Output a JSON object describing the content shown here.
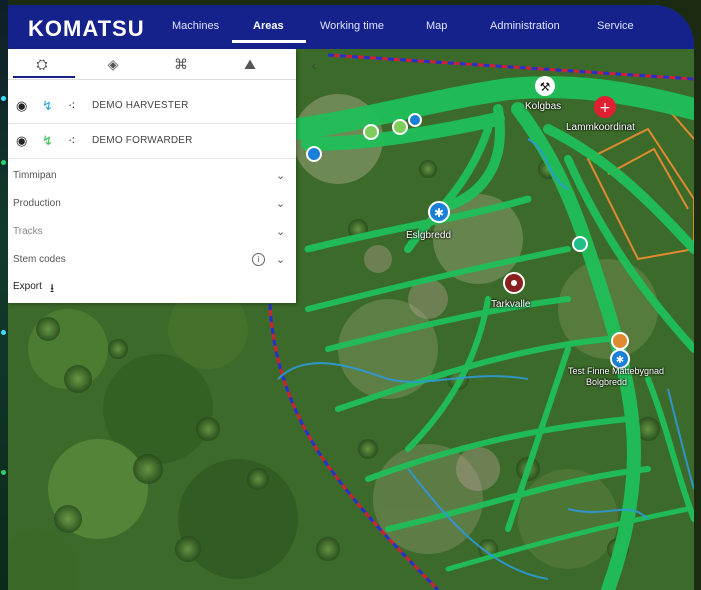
{
  "brand": {
    "logo": "KOMATSU"
  },
  "nav": {
    "items": [
      {
        "label": "Machines"
      },
      {
        "label": "Areas"
      },
      {
        "label": "Working time"
      },
      {
        "label": "Map"
      },
      {
        "label": "Administration"
      },
      {
        "label": "Service"
      }
    ],
    "active": "Areas"
  },
  "panel": {
    "tabs": [
      {
        "icon": "machine-icon"
      },
      {
        "icon": "layers-icon"
      },
      {
        "icon": "network-icon"
      },
      {
        "icon": "terrain-icon"
      }
    ],
    "collapse_icon": "chevron-left-icon",
    "machines": [
      {
        "name": "DEMO HARVESTER"
      },
      {
        "name": "DEMO FORWARDER"
      }
    ],
    "sections": [
      {
        "label": "Timmipan"
      },
      {
        "label": "Production"
      },
      {
        "label": "Tracks"
      },
      {
        "label": "Stem codes"
      }
    ],
    "export_label": "Export"
  },
  "map": {
    "labels": [
      {
        "text": "Kolgbas"
      },
      {
        "text": "Lammkoordinat"
      },
      {
        "text": "Eslgbredd"
      },
      {
        "text": "Tarkvalle"
      },
      {
        "text": "Test Finne Mattebygnad"
      },
      {
        "text": "Bolgbredd"
      }
    ],
    "colors": {
      "trail": "#1fbf5a",
      "boundary": "#2233cc",
      "track": "#2e9ad6",
      "navbar": "#15228c"
    }
  }
}
